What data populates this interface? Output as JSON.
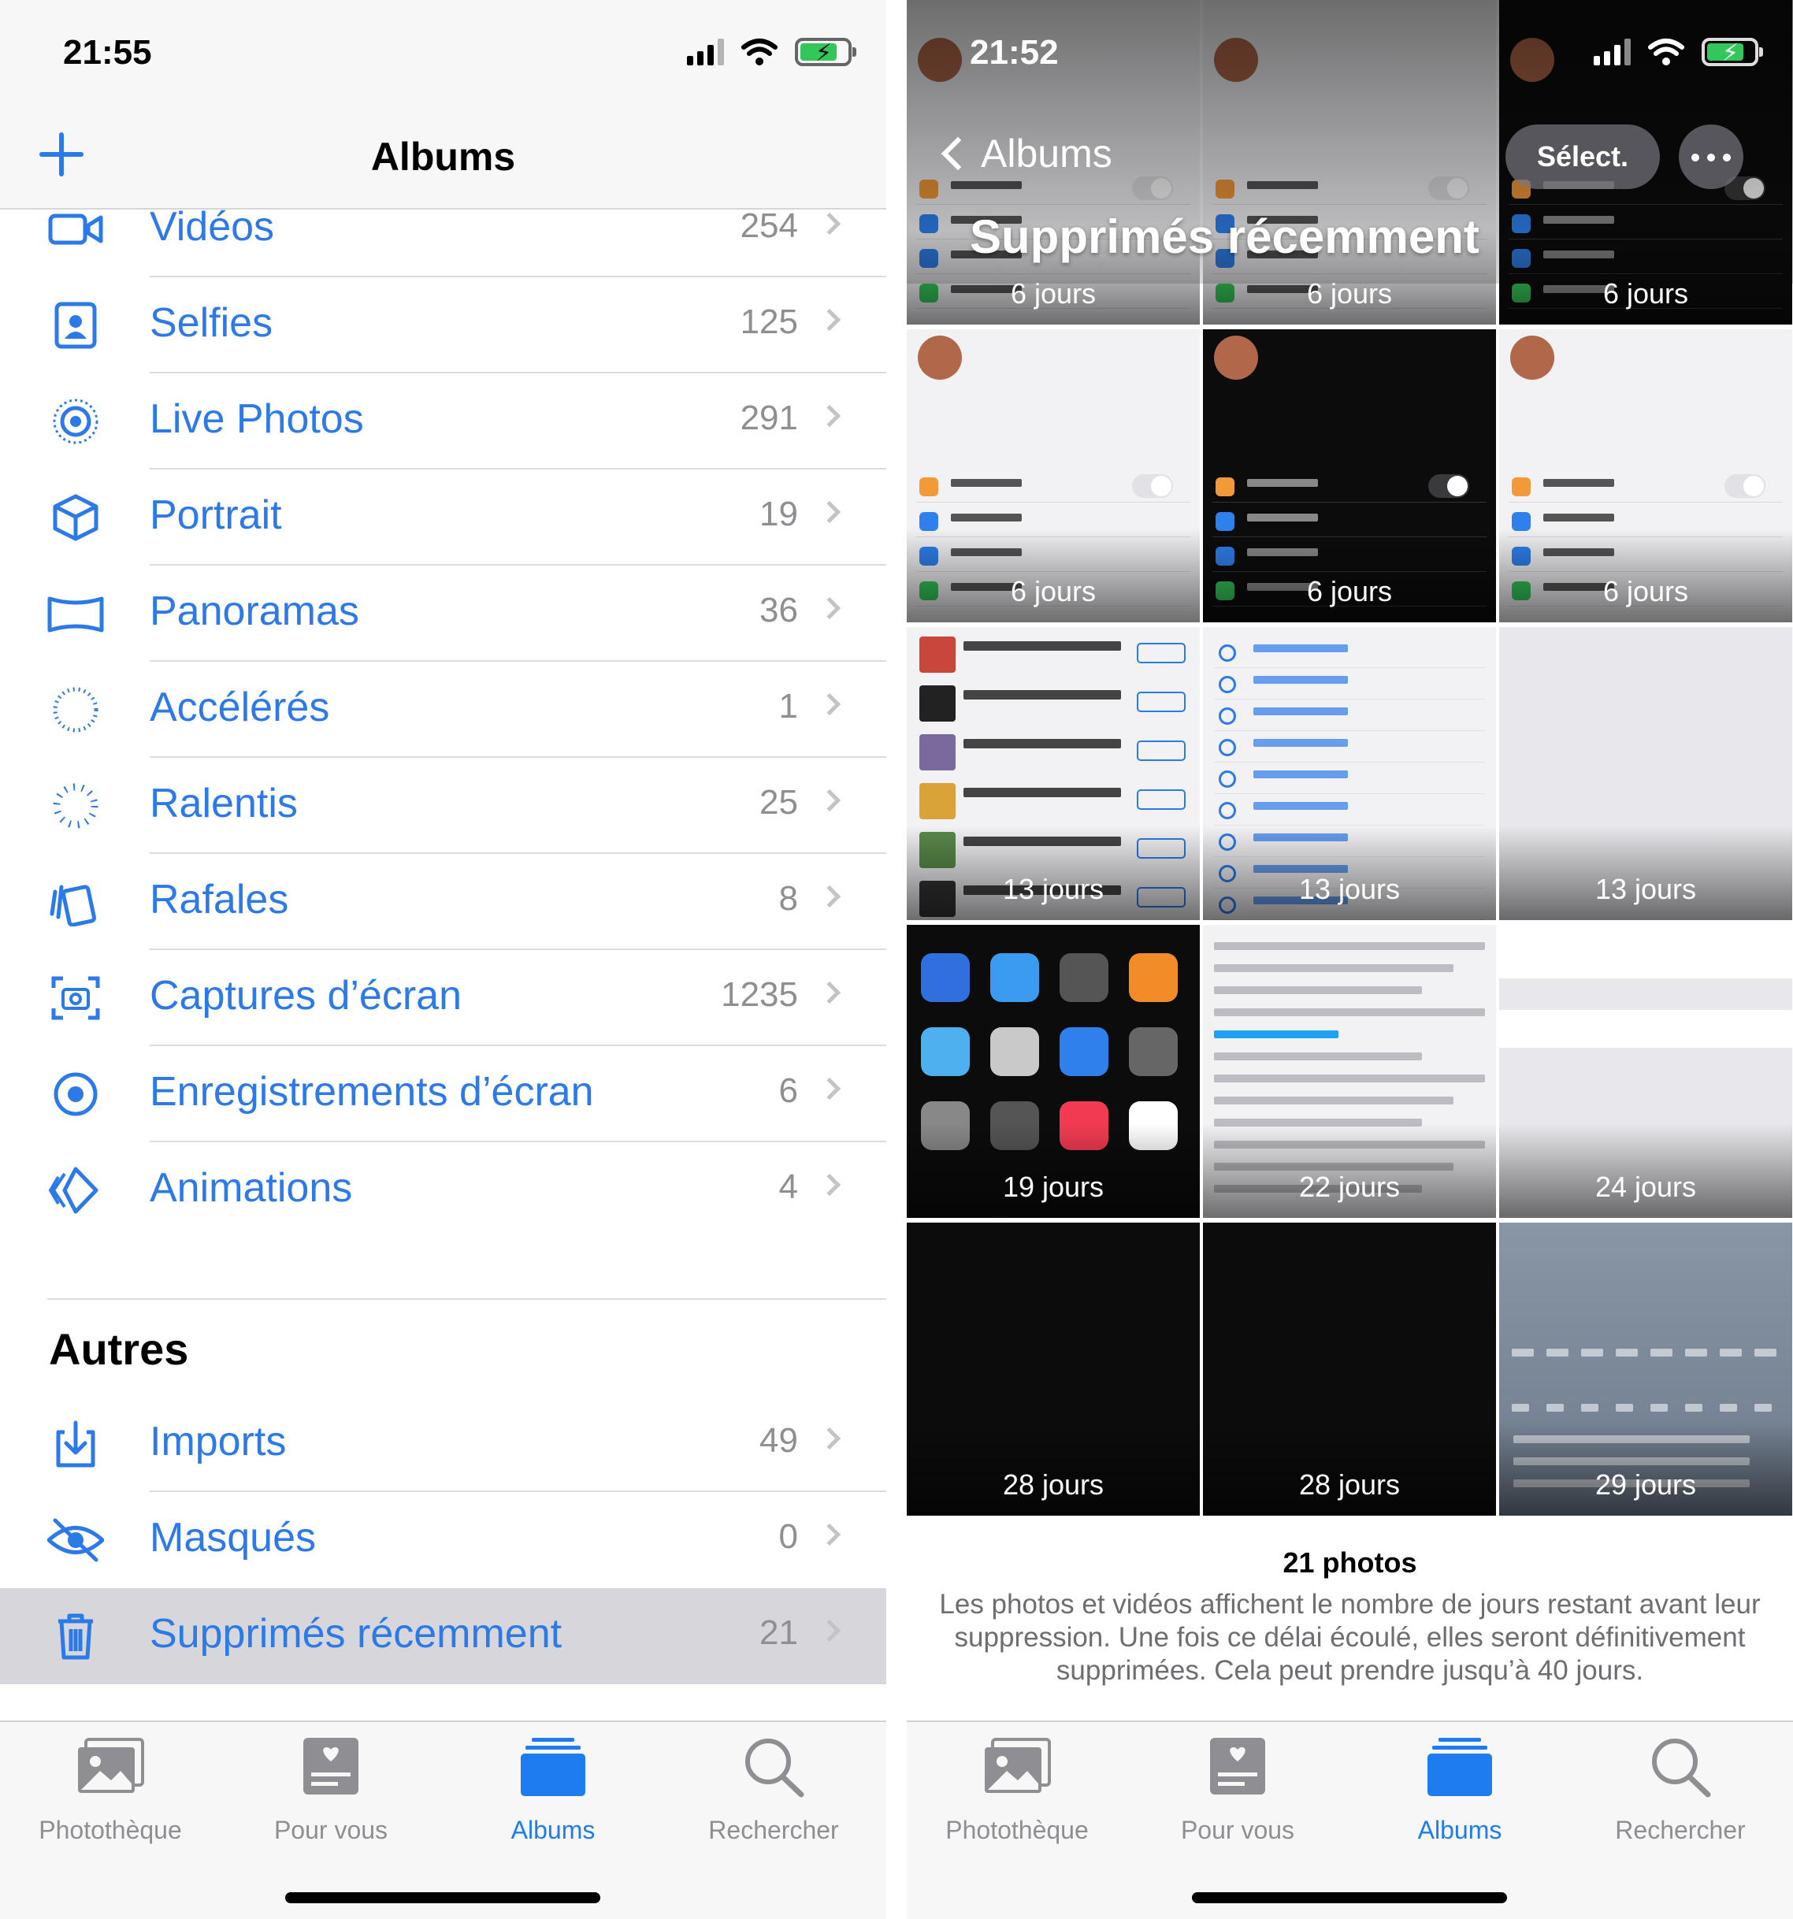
{
  "left": {
    "status": {
      "time": "21:55"
    },
    "nav": {
      "title": "Albums"
    },
    "albums": [
      {
        "label": "Vidéos",
        "count": "254",
        "icon": "video-icon"
      },
      {
        "label": "Selfies",
        "count": "125",
        "icon": "selfie-icon"
      },
      {
        "label": "Live Photos",
        "count": "291",
        "icon": "live-photos-icon"
      },
      {
        "label": "Portrait",
        "count": "19",
        "icon": "portrait-cube-icon"
      },
      {
        "label": "Panoramas",
        "count": "36",
        "icon": "panorama-icon"
      },
      {
        "label": "Accélérés",
        "count": "1",
        "icon": "timelapse-icon"
      },
      {
        "label": "Ralentis",
        "count": "25",
        "icon": "slowmo-icon"
      },
      {
        "label": "Rafales",
        "count": "8",
        "icon": "burst-icon"
      },
      {
        "label": "Captures d’écran",
        "count": "1235",
        "icon": "screenshot-icon"
      },
      {
        "label": "Enregistrements d’écran",
        "count": "6",
        "icon": "screen-recording-icon"
      },
      {
        "label": "Animations",
        "count": "4",
        "icon": "animation-icon"
      }
    ],
    "others_title": "Autres",
    "others": [
      {
        "label": "Imports",
        "count": "49",
        "icon": "import-icon"
      },
      {
        "label": "Masqués",
        "count": "0",
        "icon": "hidden-eye-icon"
      },
      {
        "label": "Supprimés récemment",
        "count": "21",
        "icon": "trash-icon",
        "selected": true
      }
    ]
  },
  "tabs": [
    {
      "label": "Photothèque",
      "icon": "photo-library-icon"
    },
    {
      "label": "Pour vous",
      "icon": "for-you-icon"
    },
    {
      "label": "Albums",
      "icon": "albums-icon",
      "active": true
    },
    {
      "label": "Rechercher",
      "icon": "search-icon"
    }
  ],
  "right": {
    "status": {
      "time": "21:52"
    },
    "back_label": "Albums",
    "title": "Supprimés récemment",
    "select_label": "Sélect.",
    "thumbnails": [
      {
        "days": "6 jours",
        "kind": "settings-light"
      },
      {
        "days": "6 jours",
        "kind": "settings-light"
      },
      {
        "days": "6 jours",
        "kind": "settings-dark"
      },
      {
        "days": "6 jours",
        "kind": "settings-light"
      },
      {
        "days": "6 jours",
        "kind": "settings-dark"
      },
      {
        "days": "6 jours",
        "kind": "settings-light"
      },
      {
        "days": "13 jours",
        "kind": "music"
      },
      {
        "days": "13 jours",
        "kind": "album-list"
      },
      {
        "days": "13 jours",
        "kind": "blank"
      },
      {
        "days": "19 jours",
        "kind": "apps"
      },
      {
        "days": "22 jours",
        "kind": "twitter"
      },
      {
        "days": "24 jours",
        "kind": "mail-settings"
      },
      {
        "days": "28 jours",
        "kind": "black"
      },
      {
        "days": "28 jours",
        "kind": "black"
      },
      {
        "days": "29 jours",
        "kind": "weather"
      }
    ],
    "photo_count": "21 photos",
    "description": "Les photos et vidéos affichent le nombre de jours restant avant leur suppression. Une fois ce délai écoulé, elles seront définitivement supprimées. Cela peut prendre jusqu’à 40 jours."
  },
  "colors": {
    "accent": "#2c79e8",
    "tab_active": "#1e7cf0",
    "tab_inactive": "#8e8e93",
    "selected_row": "#d6d6db"
  }
}
